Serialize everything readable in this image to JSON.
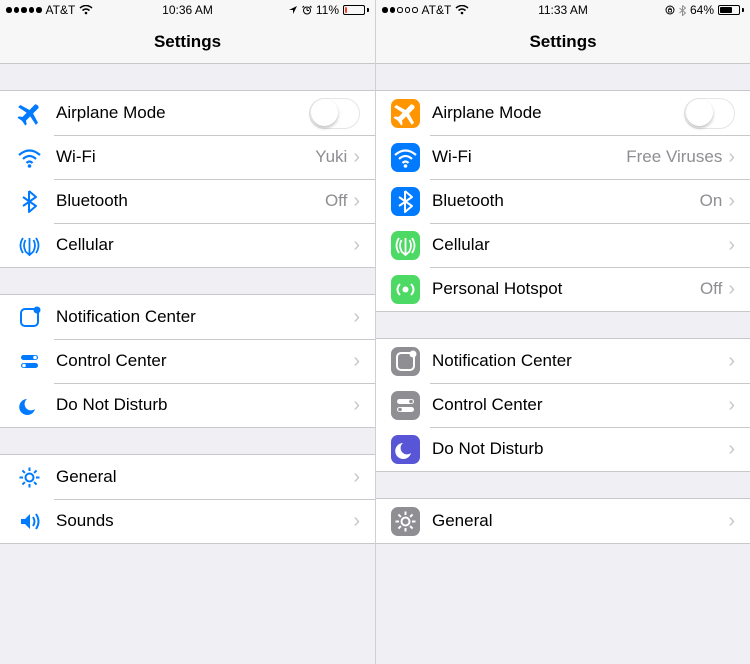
{
  "left": {
    "status": {
      "signal_filled": 5,
      "carrier": "AT&T",
      "time": "10:36 AM",
      "battery_pct": "11%",
      "battery_fill": 0.11,
      "battery_color": "#ff3b30",
      "show_location": true,
      "show_alarm": true,
      "show_lock": false,
      "show_bt": false
    },
    "nav_title": "Settings",
    "groups": [
      [
        {
          "icon": "airplane",
          "style": "outline",
          "label": "Airplane Mode",
          "switch": true
        },
        {
          "icon": "wifi",
          "style": "outline",
          "label": "Wi-Fi",
          "detail": "Yuki",
          "chev": true
        },
        {
          "icon": "bluetooth",
          "style": "outline",
          "label": "Bluetooth",
          "detail": "Off",
          "chev": true
        },
        {
          "icon": "cellular",
          "style": "outline",
          "label": "Cellular",
          "chev": true
        }
      ],
      [
        {
          "icon": "notif",
          "style": "outline",
          "label": "Notification Center",
          "chev": true
        },
        {
          "icon": "control",
          "style": "outline",
          "label": "Control Center",
          "chev": true
        },
        {
          "icon": "dnd",
          "style": "outline",
          "label": "Do Not Disturb",
          "chev": true
        }
      ],
      [
        {
          "icon": "general",
          "style": "outline",
          "label": "General",
          "chev": true
        },
        {
          "icon": "sounds",
          "style": "outline",
          "label": "Sounds",
          "chev": true
        }
      ]
    ]
  },
  "right": {
    "status": {
      "signal_filled": 2,
      "carrier": "AT&T",
      "time": "11:33 AM",
      "battery_pct": "64%",
      "battery_fill": 0.64,
      "battery_color": "#000",
      "show_location": false,
      "show_alarm": false,
      "show_lock": true,
      "show_bt": true
    },
    "nav_title": "Settings",
    "groups": [
      [
        {
          "icon": "airplane",
          "style": "solid",
          "color": "#ff9500",
          "label": "Airplane Mode",
          "switch": true
        },
        {
          "icon": "wifi",
          "style": "solid",
          "color": "#007aff",
          "label": "Wi-Fi",
          "detail": "Free Viruses",
          "chev": true
        },
        {
          "icon": "bluetooth",
          "style": "solid",
          "color": "#007aff",
          "label": "Bluetooth",
          "detail": "On",
          "chev": true
        },
        {
          "icon": "cellular",
          "style": "solid",
          "color": "#4cd964",
          "label": "Cellular",
          "chev": true
        },
        {
          "icon": "hotspot",
          "style": "solid",
          "color": "#4cd964",
          "label": "Personal Hotspot",
          "detail": "Off",
          "chev": true
        }
      ],
      [
        {
          "icon": "notif",
          "style": "solid",
          "color": "#8e8e93",
          "label": "Notification Center",
          "chev": true
        },
        {
          "icon": "control",
          "style": "solid",
          "color": "#8e8e93",
          "label": "Control Center",
          "chev": true
        },
        {
          "icon": "dnd",
          "style": "solid",
          "color": "#5856d6",
          "label": "Do Not Disturb",
          "chev": true
        }
      ],
      [
        {
          "icon": "general",
          "style": "solid",
          "color": "#8e8e93",
          "label": "General",
          "chev": true
        }
      ]
    ]
  }
}
